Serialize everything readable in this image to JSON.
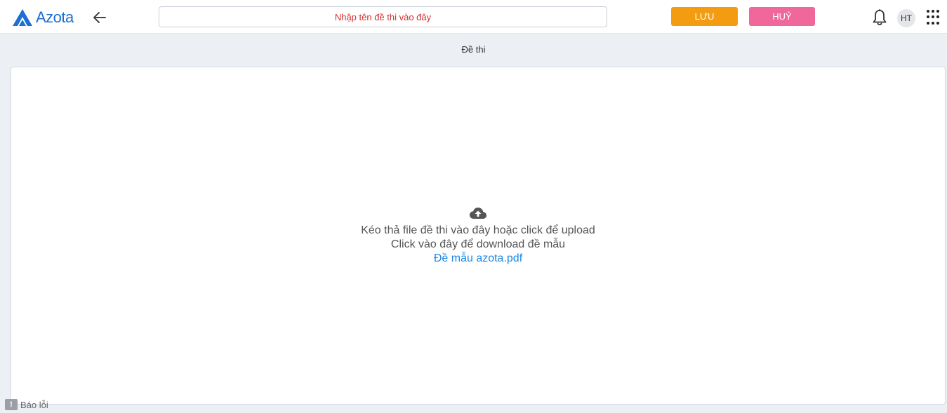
{
  "header": {
    "logo_text": "Azota",
    "title_placeholder": "Nhập tên đề thi vào đây",
    "save_label": "LƯU",
    "cancel_label": "HUỶ",
    "avatar_initials": "HT"
  },
  "section": {
    "title": "Đề thi"
  },
  "dropzone": {
    "instruction": "Kéo thả file đề thi vào đây hoặc click để upload",
    "download_hint": "Click vào đây để download đề mẫu",
    "sample_link": "Đề mẫu azota.pdf"
  },
  "footer": {
    "report_label": "Báo lỗi"
  },
  "colors": {
    "brand": "#1d6fd1",
    "save": "#f39c12",
    "cancel": "#f0679b",
    "link": "#1e88e5",
    "placeholder": "#d32f2f"
  },
  "icons": [
    "azota-logo-icon",
    "arrow-left-icon",
    "bell-icon",
    "apps-grid-icon",
    "cloud-upload-icon",
    "alert-icon"
  ]
}
